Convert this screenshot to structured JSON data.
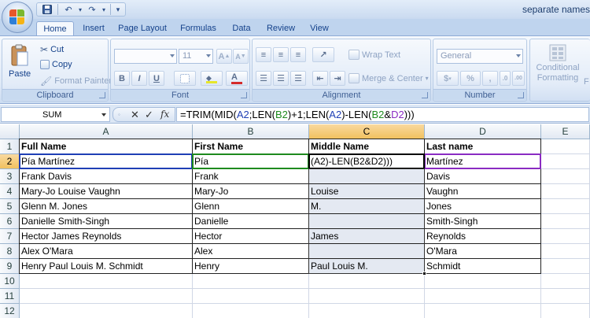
{
  "window": {
    "title": "separate names"
  },
  "qat": {
    "undo": "↶",
    "redo": "↷",
    "more": "▾",
    "save": "■"
  },
  "tabs": [
    "Home",
    "Insert",
    "Page Layout",
    "Formulas",
    "Data",
    "Review",
    "View"
  ],
  "ribbon": {
    "clipboard": {
      "label": "Clipboard",
      "paste": "Paste",
      "cut": "Cut",
      "copy": "Copy",
      "format_painter": "Format Painter"
    },
    "font": {
      "label": "Font",
      "font_name": "",
      "font_size": "11",
      "bold": "B",
      "italic": "I",
      "underline": "U",
      "grow": "A",
      "shrink": "A"
    },
    "alignment": {
      "label": "Alignment",
      "wrap_text": "Wrap Text",
      "merge_center": "Merge & Center"
    },
    "number": {
      "label": "Number",
      "format": "General",
      "currency": "$",
      "percent": "%",
      "comma": ",",
      "inc_dec": ".0",
      "dec_dec": ".00"
    },
    "styles": {
      "conditional_1": "Conditional",
      "conditional_2": "Formatting",
      "more": "F"
    }
  },
  "formula_bar": {
    "name_box": "SUM",
    "cancel": "✕",
    "enter": "✓",
    "fx": "fx",
    "formula_parts": [
      {
        "t": "=TRIM(MID(",
        "c": "#000000"
      },
      {
        "t": "A2",
        "c": "#1f3fb5"
      },
      {
        "t": ";LEN(",
        "c": "#000000"
      },
      {
        "t": "B2",
        "c": "#1e8a1e"
      },
      {
        "t": ")+1;LEN(",
        "c": "#000000"
      },
      {
        "t": "A2",
        "c": "#1f3fb5"
      },
      {
        "t": ")-LEN(",
        "c": "#000000"
      },
      {
        "t": "B2",
        "c": "#1e8a1e"
      },
      {
        "t": "&",
        "c": "#000000"
      },
      {
        "t": "D2",
        "c": "#8a2bc2"
      },
      {
        "t": ")))",
        "c": "#000000"
      }
    ]
  },
  "sheet": {
    "columns": [
      "A",
      "B",
      "C",
      "D",
      "E"
    ],
    "selected_column": "C",
    "rows": [
      "1",
      "2",
      "3",
      "4",
      "5",
      "6",
      "7",
      "8",
      "9",
      "10",
      "11",
      "12"
    ],
    "selected_row": "2",
    "headers": [
      "Full Name",
      "First Name",
      "Middle Name",
      "Last name"
    ],
    "data": [
      [
        "Pía Martínez",
        "Pía",
        "(A2)-LEN(B2&D2)))",
        "Martínez"
      ],
      [
        "Frank Davis",
        "Frank",
        "",
        "Davis"
      ],
      [
        "Mary-Jo Louise Vaughn",
        "Mary-Jo",
        "Louise",
        "Vaughn"
      ],
      [
        "Glenn M. Jones",
        "Glenn",
        "M.",
        "Jones"
      ],
      [
        "Danielle Smith-Singh",
        "Danielle",
        "",
        "Smith-Singh"
      ],
      [
        "Hector James Reynolds",
        "Hector",
        "James",
        "Reynolds"
      ],
      [
        "Alex O'Mara",
        "Alex",
        "",
        "O'Mara"
      ],
      [
        "Henry Paul Louis M. Schmidt",
        "Henry",
        "Paul Louis M.",
        "Schmidt"
      ]
    ],
    "ref_colors": {
      "A2": "#1f3fb5",
      "B2": "#1e8a1e",
      "D2": "#8a2bc2"
    }
  }
}
